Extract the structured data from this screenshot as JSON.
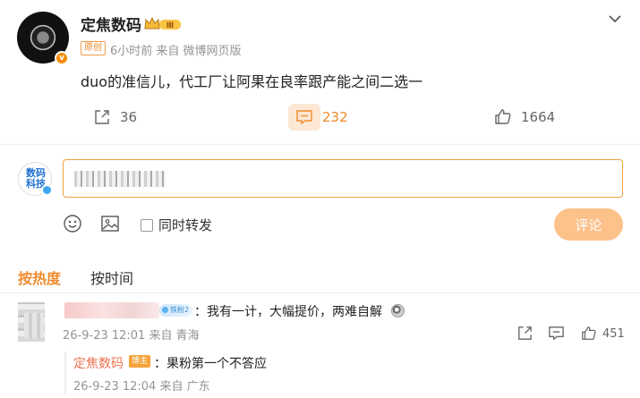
{
  "post": {
    "author": "定焦数码",
    "level_badge": "Ⅲ",
    "v_badge": "v",
    "original_tag": "原创",
    "meta": "6小时前 来自 微博网页版",
    "text": "duo的准信儿，代工厂让阿果在良率跟产能之间二选一"
  },
  "actions": {
    "repost_count": "36",
    "comment_count": "232",
    "like_count": "1664"
  },
  "composer": {
    "my_avatar_logo": "数码科技",
    "forward_label": "同时转发",
    "submit_label": "评论"
  },
  "sort": {
    "hot": "按热度",
    "time": "按时间"
  },
  "comment": {
    "fan_badge": "铁粉2",
    "text": "：我有一计，大幅提价，两难自解",
    "meta": "26-9-23 12:01 来自 青海",
    "like_count": "451"
  },
  "reply": {
    "author": "定焦数码",
    "tag": "博主",
    "text": "：果粉第一个不答应",
    "meta": "26-9-23 12:04 来自 广东"
  },
  "colors": {
    "accent": "#f08a2c",
    "reply_name": "#eb7350",
    "submit_disabled": "#fdc18a"
  }
}
